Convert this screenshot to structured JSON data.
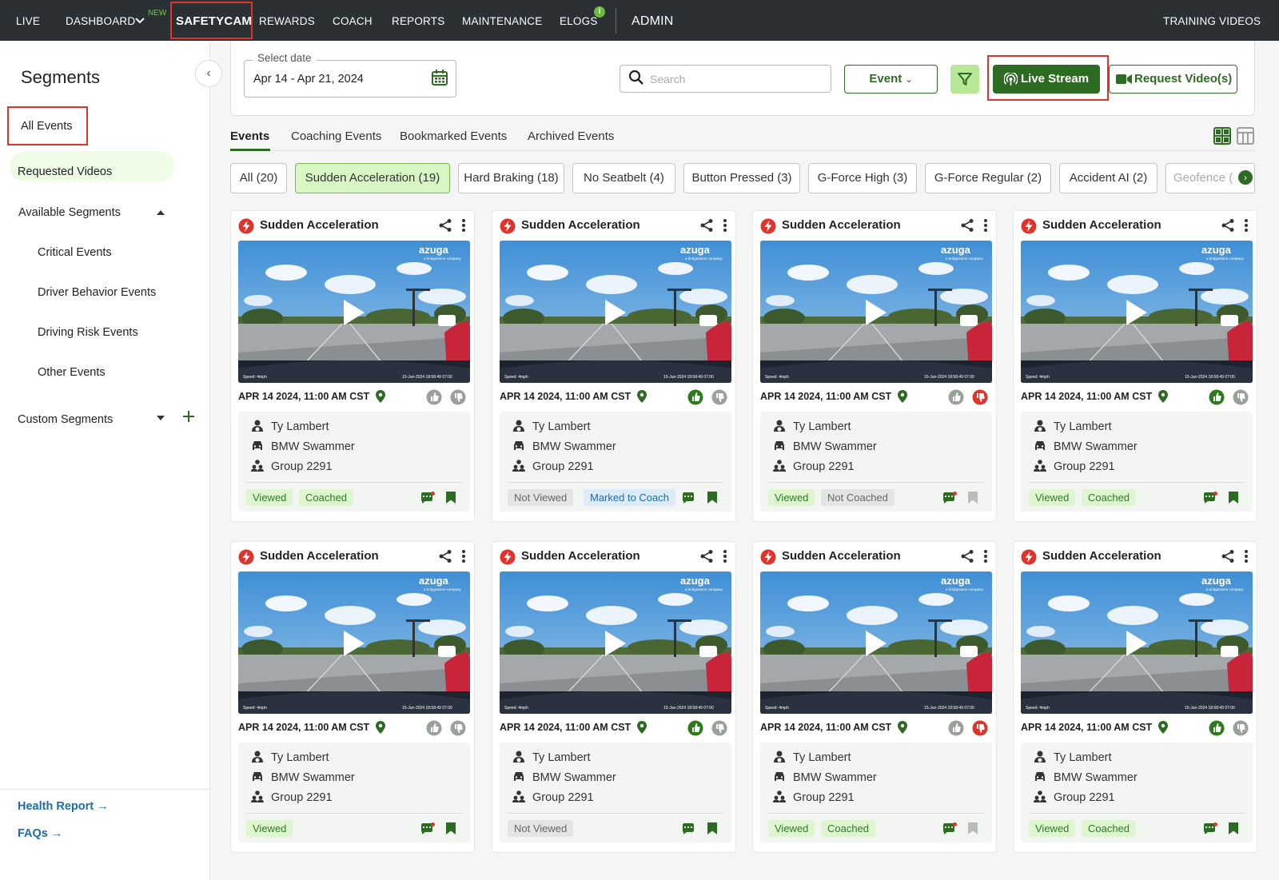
{
  "nav": {
    "items": [
      "LIVE",
      "DASHBOARD",
      "SAFETYCAM",
      "REWARDS",
      "COACH",
      "REPORTS",
      "MAINTENANCE",
      "ELOGS",
      "ADMIN"
    ],
    "new_badge": "NEW",
    "elogs_badge": "i",
    "right_link": "TRAINING VIDEOS"
  },
  "sidebar": {
    "title": "Segments",
    "all_events": "All Events",
    "requested_videos": "Requested Videos",
    "available_segments": "Available Segments",
    "sub_items": [
      "Critical Events",
      "Driver Behavior Events",
      "Driving Risk Events",
      "Other Events"
    ],
    "custom_segments": "Custom Segments",
    "health_report": "Health Report",
    "faqs": "FAQs"
  },
  "toolbar": {
    "date_label": "Select date",
    "date_value": "Apr 14 - Apr 21, 2024",
    "search_placeholder": "Search",
    "event_button": "Event",
    "live_stream": "Live Stream",
    "request_video": "Request Video(s)"
  },
  "tabs": [
    "Events",
    "Coaching Events",
    "Bookmarked Events",
    "Archived Events"
  ],
  "chips": [
    "All (20)",
    "Sudden Acceleration (19)",
    "Hard Braking (18)",
    "No Seatbelt (4)",
    "Button Pressed (3)",
    "G-Force High (3)",
    "G-Force Regular (2)",
    "Accident AI (2)",
    "Geofence ("
  ],
  "video": {
    "brand": "azuga",
    "tagline": "a bridgestone company",
    "speed": "Speed: 4mph",
    "stamp": "15-Jun-2024 18:58:49 07:00"
  },
  "colors": {
    "accent_green": "#2e6b22",
    "nav_bg": "#2b3035",
    "alert_red": "#e0332b",
    "link_blue": "#1d6ba8"
  },
  "cards": [
    {
      "title": "Sudden Acceleration",
      "date": "APR 14 2024, 11:00 AM  CST",
      "driver": "Ty Lambert",
      "vehicle": "BMW Swammer",
      "group": "Group 2291",
      "thumb_up": "grey",
      "thumb_down": "grey",
      "badges": [
        {
          "text": "Viewed",
          "style": "green"
        },
        {
          "text": "Coached",
          "style": "green"
        }
      ],
      "comment_dot": true,
      "bookmarked": true
    },
    {
      "title": "Sudden Acceleration",
      "date": "APR 14 2024, 11:00 AM  CST",
      "driver": "Ty Lambert",
      "vehicle": "BMW Swammer",
      "group": "Group 2291",
      "thumb_up": "green",
      "thumb_down": "grey",
      "badges": [
        {
          "text": "Not Viewed",
          "style": "grey"
        },
        {
          "text": "Marked to Coach",
          "style": "blue"
        }
      ],
      "comment_dot": false,
      "bookmarked": true
    },
    {
      "title": "Sudden Acceleration",
      "date": "APR 14 2024, 11:00 AM  CST",
      "driver": "Ty Lambert",
      "vehicle": "BMW Swammer",
      "group": "Group 2291",
      "thumb_up": "grey",
      "thumb_down": "red",
      "badges": [
        {
          "text": "Viewed",
          "style": "green"
        },
        {
          "text": "Not Coached",
          "style": "grey"
        }
      ],
      "comment_dot": true,
      "bookmarked": false
    },
    {
      "title": "Sudden Acceleration",
      "date": "APR 14 2024, 11:00 AM  CST",
      "driver": "Ty Lambert",
      "vehicle": "BMW Swammer",
      "group": "Group 2291",
      "thumb_up": "green",
      "thumb_down": "grey",
      "badges": [
        {
          "text": "Viewed",
          "style": "green"
        },
        {
          "text": "Coached",
          "style": "green"
        }
      ],
      "comment_dot": true,
      "bookmarked": true
    },
    {
      "title": "Sudden Acceleration",
      "date": "APR 14 2024, 11:00 AM  CST",
      "driver": "Ty Lambert",
      "vehicle": "BMW Swammer",
      "group": "Group 2291",
      "thumb_up": "grey",
      "thumb_down": "grey",
      "badges": [
        {
          "text": "Viewed",
          "style": "green"
        }
      ],
      "comment_dot": true,
      "bookmarked": true
    },
    {
      "title": "Sudden Acceleration",
      "date": "APR 14 2024, 11:00 AM  CST",
      "driver": "Ty Lambert",
      "vehicle": "BMW Swammer",
      "group": "Group 2291",
      "thumb_up": "green",
      "thumb_down": "grey",
      "badges": [
        {
          "text": "Not Viewed",
          "style": "grey"
        }
      ],
      "comment_dot": false,
      "bookmarked": true
    },
    {
      "title": "Sudden Acceleration",
      "date": "APR 14 2024, 11:00 AM  CST",
      "driver": "Ty Lambert",
      "vehicle": "BMW Swammer",
      "group": "Group 2291",
      "thumb_up": "grey",
      "thumb_down": "red",
      "badges": [
        {
          "text": "Viewed",
          "style": "green"
        },
        {
          "text": "Coached",
          "style": "green"
        }
      ],
      "comment_dot": true,
      "bookmarked": false
    },
    {
      "title": "Sudden Acceleration",
      "date": "APR 14 2024, 11:00 AM  CST",
      "driver": "Ty Lambert",
      "vehicle": "BMW Swammer",
      "group": "Group 2291",
      "thumb_up": "green",
      "thumb_down": "grey",
      "badges": [
        {
          "text": "Viewed",
          "style": "green"
        },
        {
          "text": "Coached",
          "style": "green"
        }
      ],
      "comment_dot": true,
      "bookmarked": true
    }
  ]
}
